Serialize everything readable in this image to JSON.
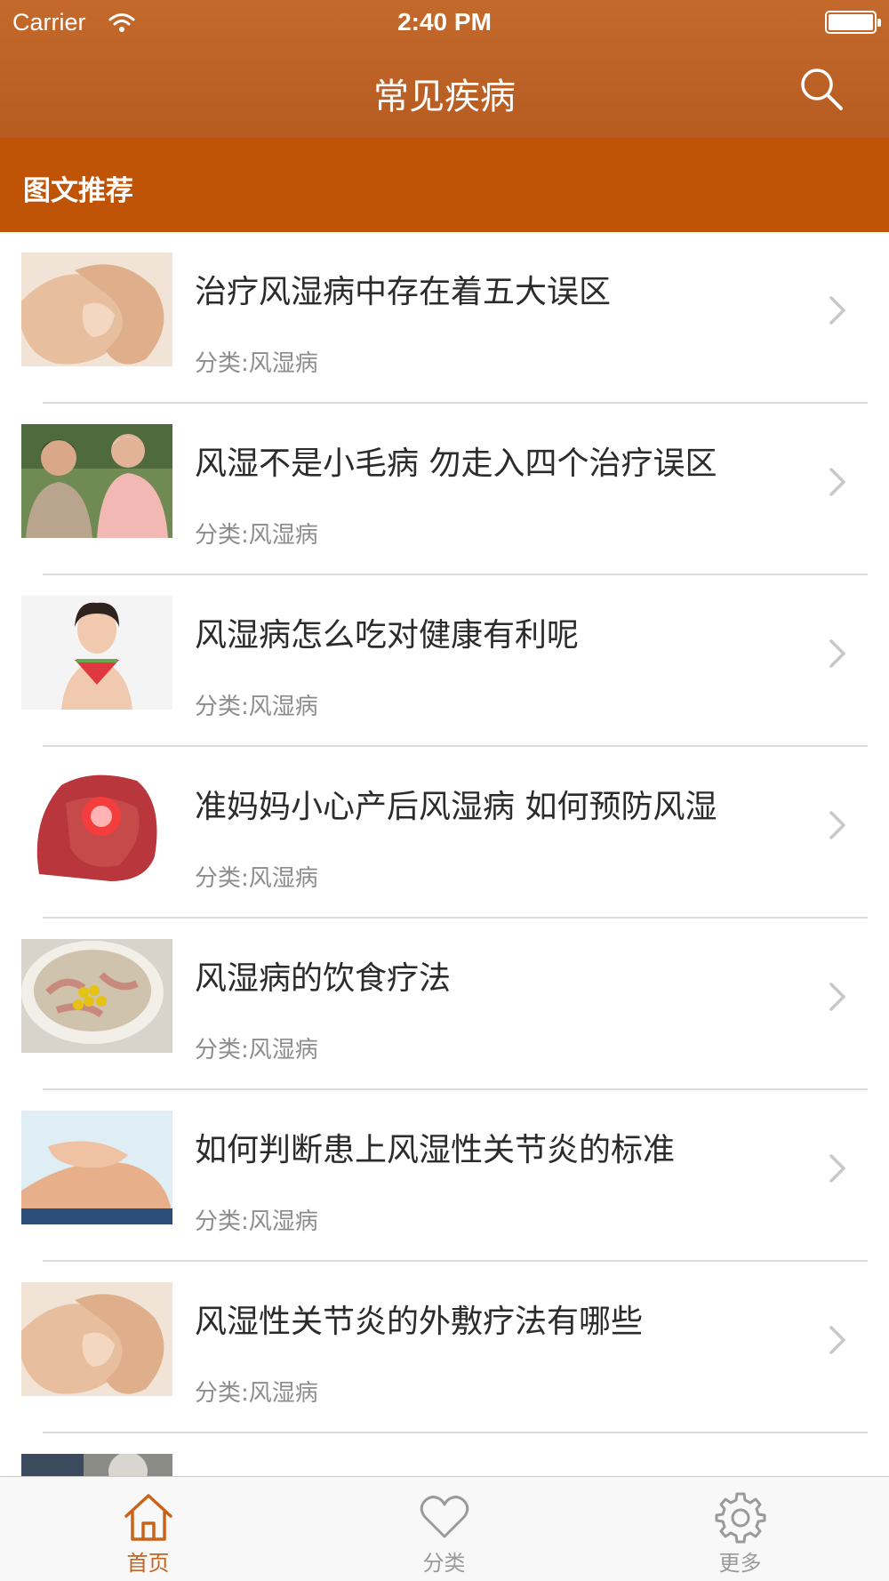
{
  "status_bar": {
    "carrier": "Carrier",
    "time": "2:40 PM"
  },
  "nav": {
    "title": "常见疾病",
    "search_icon": "search-icon"
  },
  "section": {
    "title": "图文推荐"
  },
  "articles": [
    {
      "title": "治疗风湿病中存在着五大误区",
      "category": "分类:风湿病"
    },
    {
      "title": "风湿不是小毛病 勿走入四个治疗误区",
      "category": "分类:风湿病"
    },
    {
      "title": "风湿病怎么吃对健康有利呢",
      "category": "分类:风湿病"
    },
    {
      "title": "准妈妈小心产后风湿病 如何预防风湿",
      "category": "分类:风湿病"
    },
    {
      "title": "风湿病的饮食疗法",
      "category": "分类:风湿病"
    },
    {
      "title": "如何判断患上风湿性关节炎的标准",
      "category": "分类:风湿病"
    },
    {
      "title": "风湿性关节炎的外敷疗法有哪些",
      "category": "分类:风湿病"
    },
    {
      "title": "",
      "category": ""
    }
  ],
  "tabs": [
    {
      "label": "首页",
      "icon": "home-icon",
      "active": true
    },
    {
      "label": "分类",
      "icon": "heart-icon",
      "active": false
    },
    {
      "label": "更多",
      "icon": "gear-icon",
      "active": false
    }
  ],
  "colors": {
    "nav_bar": "#bd6226",
    "section_header": "#bf5306",
    "accent": "#c96319",
    "tab_inactive": "#9a9a9a"
  }
}
